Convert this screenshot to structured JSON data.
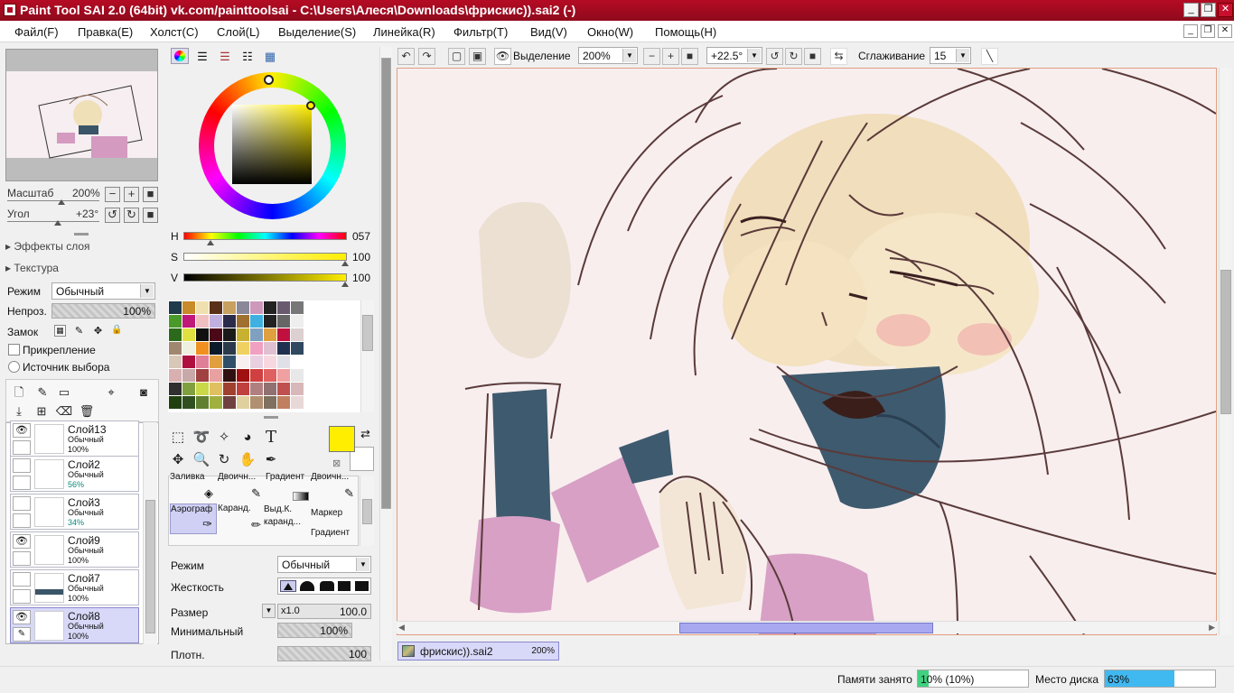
{
  "titlebar": {
    "title": "Paint Tool SAI 2.0 (64bit) vk.com/painttoolsai - C:\\Users\\Алеся\\Downloads\\фрискис)).sai2 (-)"
  },
  "menu": [
    "Файл(F)",
    "Правка(E)",
    "Холст(C)",
    "Слой(L)",
    "Выделение(S)",
    "Линейка(R)",
    "Фильтр(T)",
    "Вид(V)",
    "Окно(W)",
    "Помощь(H)"
  ],
  "navigator": {
    "zoom_label": "Масштаб",
    "zoom_value": "200%",
    "angle_label": "Угол",
    "angle_value": "+23°"
  },
  "layer_panel": {
    "effects": "Эффекты слоя",
    "texture": "Текстура",
    "mode_label": "Режим",
    "mode_value": "Обычный",
    "opacity_label": "Непроз.",
    "opacity_value": "100%",
    "lock_label": "Замок",
    "clip_label": "Прикрепление",
    "source_label": "Источник выбора"
  },
  "layers": [
    {
      "name": "Слой13",
      "mode": "Обычный",
      "opacity": "100%",
      "visible": true
    },
    {
      "name": "Слой2",
      "mode": "Обычный",
      "opacity": "56%",
      "visible": false
    },
    {
      "name": "Слой3",
      "mode": "Обычный",
      "opacity": "34%",
      "visible": false
    },
    {
      "name": "Слой9",
      "mode": "Обычный",
      "opacity": "100%",
      "visible": true
    },
    {
      "name": "Слой7",
      "mode": "Обычный",
      "opacity": "100%",
      "visible": false
    },
    {
      "name": "Слой8",
      "mode": "Обычный",
      "opacity": "100%",
      "visible": true
    }
  ],
  "color": {
    "h_label": "H",
    "h_value": "057",
    "s_label": "S",
    "s_value": "100",
    "v_label": "V",
    "v_value": "100",
    "current": "#ffee00"
  },
  "swatches": [
    "#1f3a4a",
    "#c98a2a",
    "#f0e0b0",
    "#5a3018",
    "#c8a060",
    "#8a8898",
    "#cc99bb",
    "#222222",
    "#6a5a70",
    "#777777",
    "#4a9a2a",
    "#c01878",
    "#f0c0c0",
    "#c0b0e0",
    "#2a2a4a",
    "#a07030",
    "#40b0e0",
    "#222222",
    "#666666",
    "#eeeeee",
    "#2a6a1a",
    "#e0e040",
    "#101010",
    "#4a0818",
    "#1a1a1a",
    "#c8b030",
    "#80a0c0",
    "#e0a040",
    "#c01040",
    "#ddd0d0",
    "#a08870",
    "#f0f0e0",
    "#f09020",
    "#0a1a2a",
    "#2a3a4a",
    "#f0d060",
    "#f0a0c0",
    "#e0c0d0",
    "#203050",
    "#304860",
    "#d8c8b8",
    "#b01040",
    "#e08098",
    "#e0a040",
    "#30506a",
    "#f8f0f0",
    "#e8d0e0",
    "#f8d8e0",
    "#e0e0e8",
    "#ffffff",
    "#d8b0b0",
    "#c8a8a8",
    "#a04040",
    "#e8a0a0",
    "#301010",
    "#a01010",
    "#d04040",
    "#e06060",
    "#f0a0a0",
    "#e8e8e8",
    "#303030",
    "#80a040",
    "#c8d848",
    "#e0c060",
    "#a04030",
    "#c04040",
    "#b08080",
    "#907070",
    "#c05050",
    "#d8b8b8",
    "#204010",
    "#305020",
    "#608030",
    "#a0b040",
    "#704040",
    "#e0d0a0",
    "#b09070",
    "#807060",
    "#c08060",
    "#e8d8d8"
  ],
  "tools": {
    "brushes": [
      {
        "name": "Заливка"
      },
      {
        "name": "Двоичн..."
      },
      {
        "name": "Градиент"
      },
      {
        "name": "Двоичн..."
      },
      {
        "name": "Аэрограф"
      },
      {
        "name": "Каранд."
      },
      {
        "name": "Выд.К. каранд..."
      },
      {
        "name": "Маркер Градиент"
      }
    ],
    "mode_label": "Режим",
    "mode_value": "Обычный",
    "hardness_label": "Жесткость",
    "size_label": "Размер",
    "size_mult": "x1.0",
    "size_value": "100.0",
    "min_label": "Минимальный",
    "min_value": "100%",
    "density_label": "Плотн.",
    "density_value": "100"
  },
  "toolbar": {
    "selection_label": "Выделение",
    "zoom_value": "200%",
    "angle_value": "+22.5°",
    "smoothing_label": "Сглаживание",
    "smoothing_value": "15"
  },
  "document_tab": {
    "name": "фрискис)).sai2",
    "zoom": "200%"
  },
  "statusbar": {
    "memory_label": "Памяти занято",
    "memory_value": "10% (10%)",
    "memory_fraction": 0.1,
    "disk_label": "Место диска",
    "disk_value": "63%",
    "disk_fraction": 0.63
  }
}
